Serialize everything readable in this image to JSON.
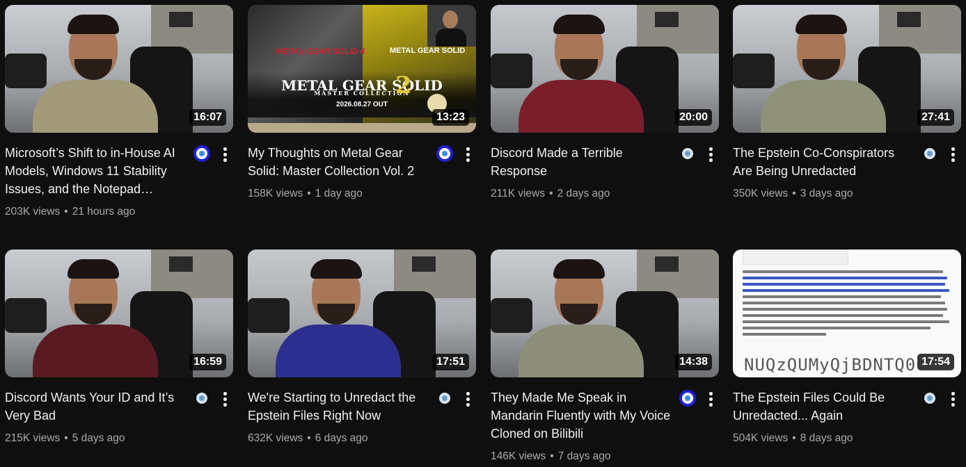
{
  "videos": [
    {
      "title": "Microsoft’s Shift to in-House AI Models, Windows 11 Stability Issues, and the Notepad…",
      "views": "203K views",
      "age": "21 hours ago",
      "duration": "16:07",
      "badge": "strong",
      "shirt": "#a39a7a",
      "wall": "#c9ccd0"
    },
    {
      "title": "My Thoughts on Metal Gear Solid: Master Collection Vol. 2",
      "views": "158K views",
      "age": "1 day ago",
      "duration": "13:23",
      "badge": "strong",
      "poster": {
        "left_logo": "METAL GEAR SOLID 4",
        "right_logo": "METAL GEAR SOLID",
        "main": "METAL GEAR SOLID",
        "sub": "MASTER COLLECTION",
        "vol": "2",
        "date": "2026.08.27 OUT"
      }
    },
    {
      "title": "Discord Made a Terrible Response",
      "views": "211K views",
      "age": "2 days ago",
      "duration": "20:00",
      "badge": "soft",
      "shirt": "#7a1f2a",
      "wall": "#c5c8cc"
    },
    {
      "title": "The Epstein Co-Conspirators Are Being Unredacted",
      "views": "350K views",
      "age": "3 days ago",
      "duration": "27:41",
      "badge": "soft",
      "shirt": "#8f9279",
      "wall": "#c9ccd0"
    },
    {
      "title": "Discord Wants Your ID and It’s Very Bad",
      "views": "215K views",
      "age": "5 days ago",
      "duration": "16:59",
      "badge": "soft",
      "shirt": "#5a1a22",
      "wall": "#c9ccd0"
    },
    {
      "title": "We're Starting to Unredact the Epstein Files Right Now",
      "views": "632K views",
      "age": "6 days ago",
      "duration": "17:51",
      "badge": "soft",
      "shirt": "#2c2f8f",
      "wall": "#c5c8cc"
    },
    {
      "title": "They Made Me Speak in Mandarin Fluently with My Voice Cloned on Bilibili",
      "views": "146K views",
      "age": "7 days ago",
      "duration": "14:38",
      "badge": "strong",
      "shirt": "#8d8f7a",
      "wall": "#c9ccd0"
    },
    {
      "title": "The Epstein Files Could Be Unredacted... Again",
      "views": "504K views",
      "age": "8 days ago",
      "duration": "17:54",
      "badge": "soft",
      "doc_glyphs": "NUQzQUMyQjBDNTQ0"
    }
  ]
}
